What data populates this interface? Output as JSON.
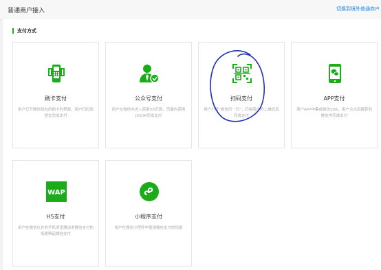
{
  "header": {
    "title": "普通商户接入",
    "switch_link": "切换到境外普通商户"
  },
  "section": {
    "title": "支付方式"
  },
  "cards": [
    {
      "title": "刷卡支付",
      "desc": "用户打开微信钱包的刷卡的界面，商户扫码后提交完成支付",
      "icon": "pos-terminal-icon"
    },
    {
      "title": "公众号支付",
      "desc": "用户在微信内进入商家H5页面，页面内调用JSSDK完成支付",
      "icon": "verified-user-icon"
    },
    {
      "title": "扫码支付",
      "desc": "用户打开\"微信扫一扫\"，扫描商户的二维码后完成支付",
      "icon": "qr-scan-icon"
    },
    {
      "title": "APP支付",
      "desc": "商户APP中集成微信SDK，用户点击后跳转到微信内完成支付",
      "icon": "mobile-chat-icon"
    },
    {
      "title": "H5支付",
      "desc": "用户在微信以外的手机浏览器请求微信支付的场景唤起微信支付",
      "icon": "wap-icon"
    },
    {
      "title": "小程序支付",
      "desc": "用户在微信小程序中使用微信支付的场景",
      "icon": "mini-program-icon"
    }
  ],
  "colors": {
    "accent": "#1aad19",
    "link": "#1e88e5",
    "annotation": "#1f2fb5"
  }
}
